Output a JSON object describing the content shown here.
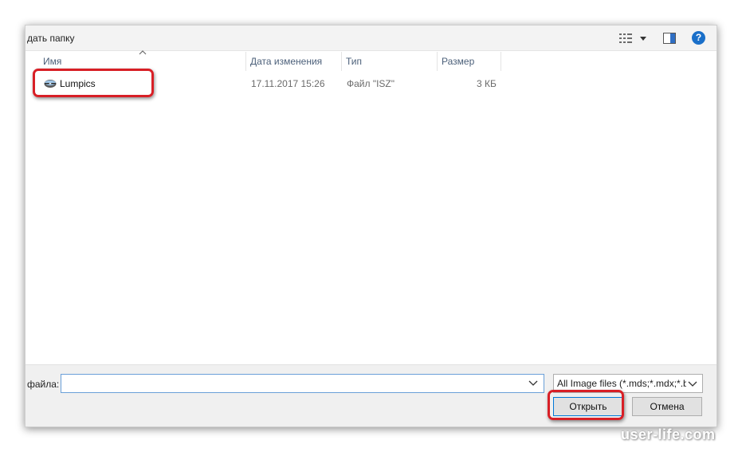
{
  "toolbar": {
    "new_folder_label": "дать папку",
    "view_icon": "view-menu-icon",
    "preview_pane_icon": "preview-pane-icon",
    "help_label": "?"
  },
  "columns": {
    "name": "Имя",
    "date": "Дата изменения",
    "type": "Тип",
    "size": "Размер"
  },
  "files": [
    {
      "name": "Lumpics",
      "date": "17.11.2017 15:26",
      "type": "Файл \"ISZ\"",
      "size": "3 КБ",
      "icon": "disc-image-icon"
    }
  ],
  "bottom": {
    "file_name_label": "файла:",
    "file_name_value": "",
    "file_type_value": "All Image files (*.mds;*.mdx;*.b",
    "open_label": "Открыть",
    "cancel_label": "Отмена"
  },
  "watermark": "user-life.com",
  "colors": {
    "highlight": "#d81f26",
    "help_blue": "#1a6fc9",
    "focus_border": "#0078d7"
  }
}
